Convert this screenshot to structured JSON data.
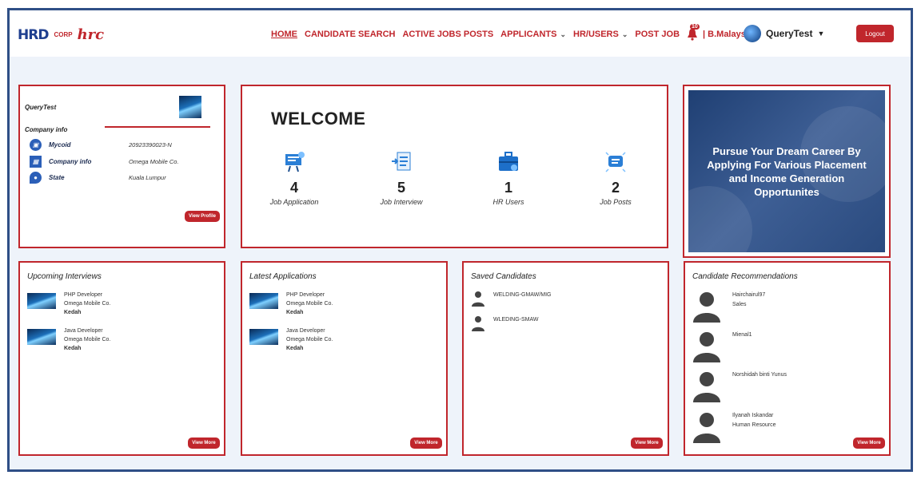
{
  "brand": {
    "hrd": "HRD",
    "corp": "CORP",
    "hrc": "hrc"
  },
  "nav": {
    "home": "HOME",
    "candidate_search": "CANDIDATE SEARCH",
    "active_jobs": "ACTIVE JOBS POSTS",
    "applicants": "APPLICANTS",
    "hr_users": "HR/USERS",
    "post_job": "POST JOB",
    "notification_count": "10",
    "country": "| B.Malaysia",
    "username": "QueryTest",
    "logout": "Logout"
  },
  "profile": {
    "name": "QueryTest",
    "section": "Company info",
    "rows": [
      {
        "label": "Mycoid",
        "value": "20923390023-N"
      },
      {
        "label": "Company info",
        "value": "Omega Mobile Co."
      },
      {
        "label": "State",
        "value": "Kuala Lumpur"
      }
    ],
    "button": "View Profile"
  },
  "welcome": {
    "title": "WELCOME",
    "stats": [
      {
        "value": "4",
        "label": "Job Application"
      },
      {
        "value": "5",
        "label": "Job Interview"
      },
      {
        "value": "1",
        "label": "HR Users"
      },
      {
        "value": "2",
        "label": "Job Posts"
      }
    ]
  },
  "banner": {
    "text": "Pursue Your Dream Career By Applying For Various Placement and Income Generation Opportunites"
  },
  "interviews": {
    "title": "Upcoming Interviews",
    "items": [
      {
        "job": "PHP Developer",
        "company": "Omega Mobile Co.",
        "state": "Kedah"
      },
      {
        "job": "Java Developer",
        "company": "Omega Mobile Co.",
        "state": "Kedah"
      }
    ],
    "button": "View More"
  },
  "applications": {
    "title": "Latest Applications",
    "items": [
      {
        "job": "PHP Developer",
        "company": "Omega Mobile Co.",
        "state": "Kedah"
      },
      {
        "job": "Java Developer",
        "company": "Omega Mobile Co.",
        "state": "Kedah"
      }
    ],
    "button": "View More"
  },
  "saved": {
    "title": "Saved Candidates",
    "items": [
      "WELDING-GMAW/MIG",
      "WLEDING-SMAW"
    ],
    "button": "View More"
  },
  "recommendations": {
    "title": "Candidate Recommendations",
    "items": [
      {
        "name": "Hairchairul97",
        "role": "Sales"
      },
      {
        "name": "Mienal1",
        "role": ""
      },
      {
        "name": "Norshidah binti Yunus",
        "role": ""
      },
      {
        "name": "Ilyanah Iskandar",
        "role": "Human Resource"
      }
    ],
    "button": "View More"
  },
  "colors": {
    "accent": "#c0262c",
    "frame": "#2f4f86"
  }
}
